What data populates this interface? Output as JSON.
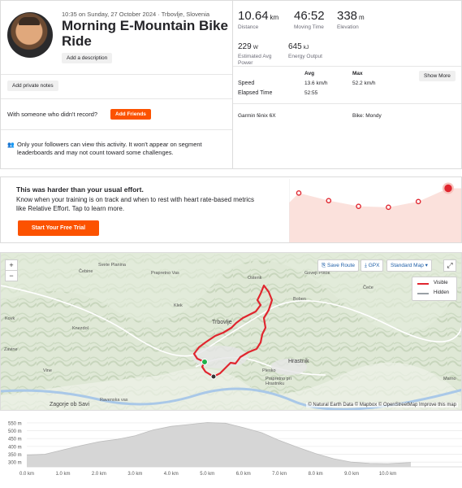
{
  "activity": {
    "meta": "10:35 on Sunday, 27 October 2024 · Trbovlje, Slovenia",
    "title": "Morning E-Mountain Bike Ride",
    "add_description": "Add a description",
    "add_private_notes": "Add private notes",
    "with_someone_text": "With someone who didn't record?",
    "add_friends": "Add Friends",
    "privacy_icon": "people-icon",
    "privacy_text": "Only your followers can view this activity. It won't appear on segment leaderboards and may not count toward some challenges."
  },
  "stats": {
    "distance": {
      "value": "10.64",
      "unit": "km",
      "label": "Distance"
    },
    "moving_time": {
      "value": "46:52",
      "label": "Moving Time"
    },
    "elevation": {
      "value": "338",
      "unit": "m",
      "label": "Elevation"
    },
    "power": {
      "value": "229",
      "unit": "W",
      "label": "Estimated Avg Power"
    },
    "energy": {
      "value": "645",
      "unit": "kJ",
      "label": "Energy Output"
    },
    "table": {
      "col_avg": "Avg",
      "col_max": "Max",
      "speed_label": "Speed",
      "speed_avg": "13.6 km/h",
      "speed_max": "52.2 km/h",
      "elapsed_label": "Elapsed Time",
      "elapsed_avg": "52:55"
    },
    "show_more": "Show More",
    "device": "Garmin fēnix 6X",
    "bike": "Bike: Mondy"
  },
  "effort": {
    "title": "This was harder than your usual effort.",
    "body": "Know when your training is on track and when to rest with heart rate-based metrics like Relative Effort. Tap to learn more.",
    "cta": "Start Your Free Trial",
    "trend_values": [
      52,
      44,
      38,
      37,
      43,
      57
    ]
  },
  "map": {
    "zoom_in": "+",
    "zoom_out": "−",
    "save_route": "Save Route",
    "gpx": "GPX",
    "map_style": "Standard Map",
    "legend_visible": "Visible",
    "legend_hidden": "Hidden",
    "attribution": "© Natural Earth Data © Mapbox © OpenStreetMap Improve this map",
    "places": {
      "p1": "Svete Planina",
      "p2": "Čebine",
      "p3": "Prapretno Vas",
      "p4": "Klek",
      "p5": "Knezdol",
      "p6": "Zavine",
      "p7": "Vine",
      "p8": "Ravenska vas",
      "p9": "Zagorje ob Savi",
      "p10": "Ostenk",
      "p11": "Govejt Potok",
      "p12": "Boben",
      "p13": "Trbovlje",
      "p14": "Hrastnik",
      "p15": "Plesko",
      "p16": "Prapretno pri Hrastniku",
      "p17": "Marno",
      "p18": "Čeče",
      "p19": "Kovk"
    },
    "colors": {
      "visible": "#e0262f",
      "hidden": "#9aa0a6"
    }
  },
  "elevation": {
    "y_ticks": [
      "550 m",
      "500 m",
      "450 m",
      "400 m",
      "350 m",
      "300 m"
    ],
    "x_ticks": [
      "0.0 km",
      "1.0 km",
      "2.0 km",
      "3.0 km",
      "4.0 km",
      "5.0 km",
      "6.0 km",
      "7.0 km",
      "8.0 km",
      "9.0 km",
      "10.0 km"
    ],
    "profile_km": [
      0,
      0.5,
      1.0,
      1.5,
      2.0,
      2.5,
      3.0,
      3.5,
      4.0,
      4.5,
      5.0,
      5.5,
      6.0,
      6.5,
      7.0,
      7.5,
      8.0,
      8.5,
      9.0,
      9.5,
      10.0,
      10.64
    ],
    "profile_m": [
      345,
      350,
      378,
      405,
      430,
      445,
      468,
      505,
      528,
      540,
      552,
      548,
      520,
      488,
      438,
      395,
      355,
      322,
      300,
      292,
      290,
      298
    ],
    "y_min": 270,
    "y_max": 560,
    "x_max": 10.64
  }
}
